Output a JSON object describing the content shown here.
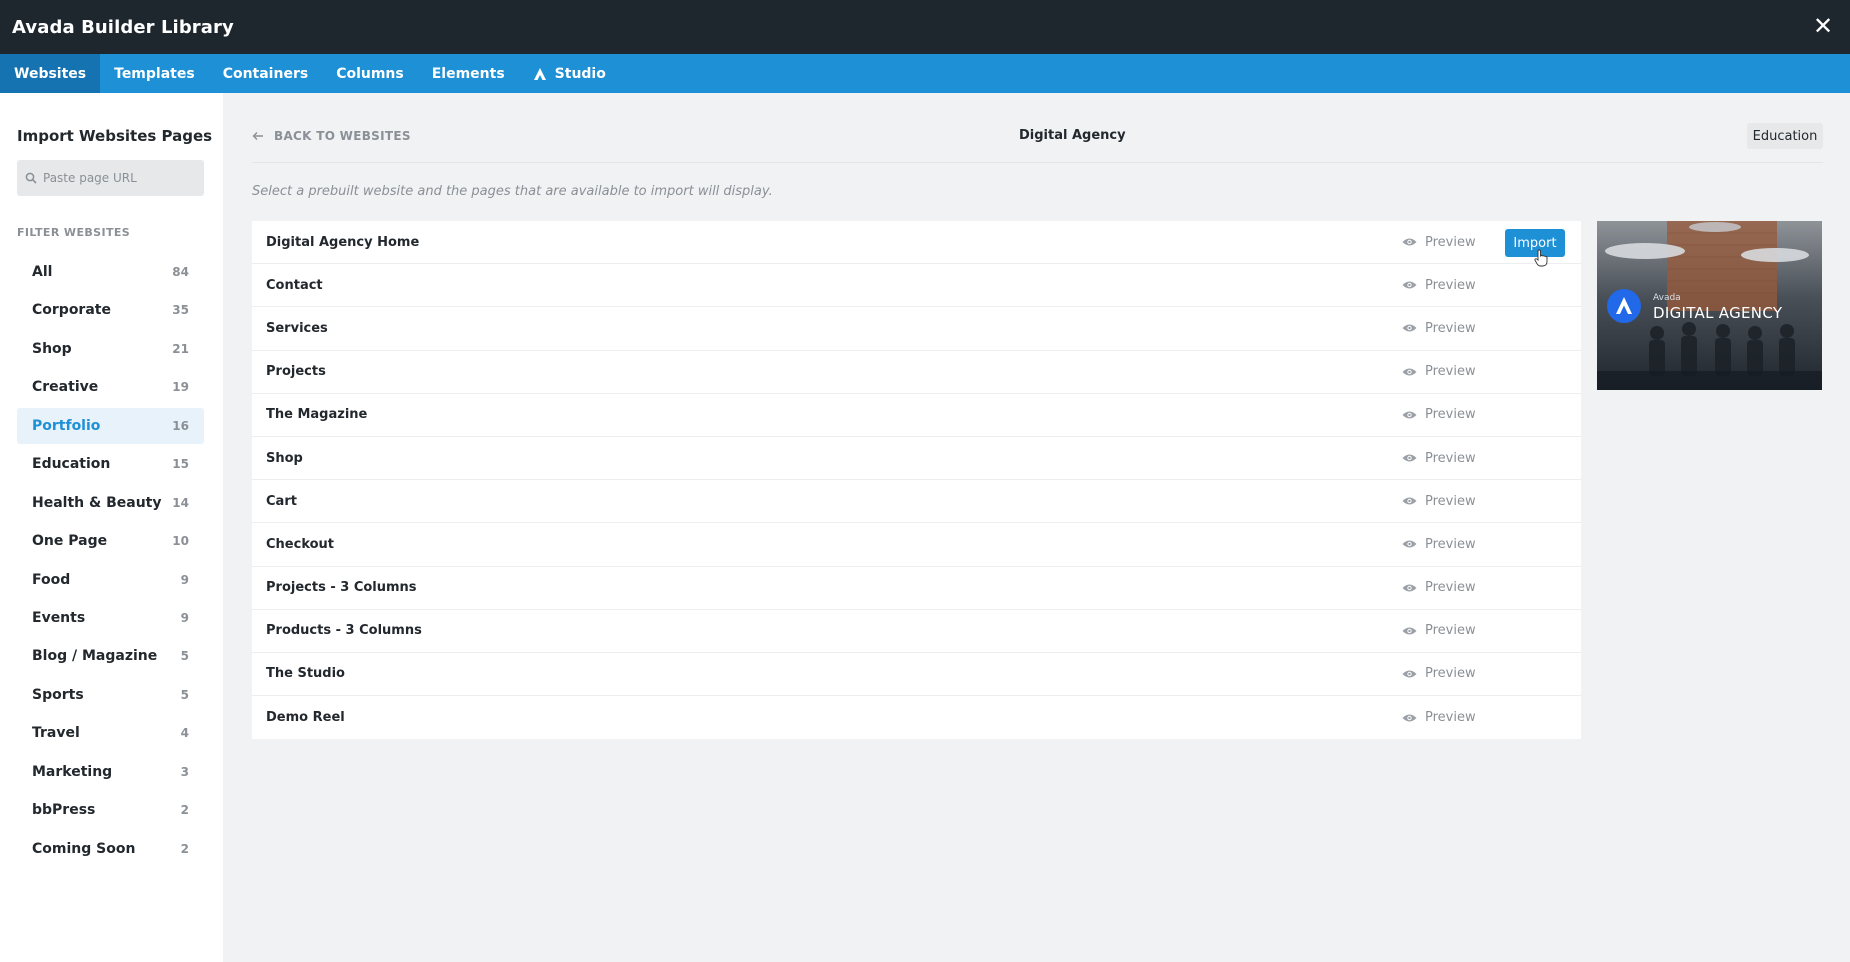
{
  "window": {
    "title": "Avada Builder Library",
    "close_glyph": "✕"
  },
  "tabs": [
    {
      "label": "Websites"
    },
    {
      "label": "Templates"
    },
    {
      "label": "Containers"
    },
    {
      "label": "Columns"
    },
    {
      "label": "Elements"
    },
    {
      "label": "Studio",
      "icon": "avada-logo-icon"
    }
  ],
  "sidebar": {
    "title": "Import Websites Pages",
    "search_placeholder": "Paste page URL",
    "filter_label": "FILTER WEBSITES",
    "filters": [
      {
        "label": "All",
        "count": "84"
      },
      {
        "label": "Corporate",
        "count": "35"
      },
      {
        "label": "Shop",
        "count": "21"
      },
      {
        "label": "Creative",
        "count": "19"
      },
      {
        "label": "Portfolio",
        "count": "16"
      },
      {
        "label": "Education",
        "count": "15"
      },
      {
        "label": "Health & Beauty",
        "count": "14"
      },
      {
        "label": "One Page",
        "count": "10"
      },
      {
        "label": "Food",
        "count": "9"
      },
      {
        "label": "Events",
        "count": "9"
      },
      {
        "label": "Blog / Magazine",
        "count": "5"
      },
      {
        "label": "Sports",
        "count": "5"
      },
      {
        "label": "Travel",
        "count": "4"
      },
      {
        "label": "Marketing",
        "count": "3"
      },
      {
        "label": "bbPress",
        "count": "2"
      },
      {
        "label": "Coming Soon",
        "count": "2"
      }
    ]
  },
  "main": {
    "back_label": "BACK TO WEBSITES",
    "site_title": "Digital Agency",
    "category_badge": "Education",
    "hint": "Select a prebuilt website and the pages that are available to import will display.",
    "preview_label": "Preview",
    "import_label": "Import",
    "pages": [
      "Digital Agency Home",
      "Contact",
      "Services",
      "Projects",
      "The Magazine",
      "Shop",
      "Cart",
      "Checkout",
      "Projects - 3 Columns",
      "Products - 3 Columns",
      "The Studio",
      "Demo Reel"
    ],
    "thumbnail": {
      "brand_small": "Avada",
      "brand_big": "DIGITAL AGENCY"
    }
  },
  "colors": {
    "tab_bar": "#1e90d6",
    "tab_active": "#1573b1",
    "title_bar": "#1f272e",
    "accent": "#1e90d6"
  }
}
